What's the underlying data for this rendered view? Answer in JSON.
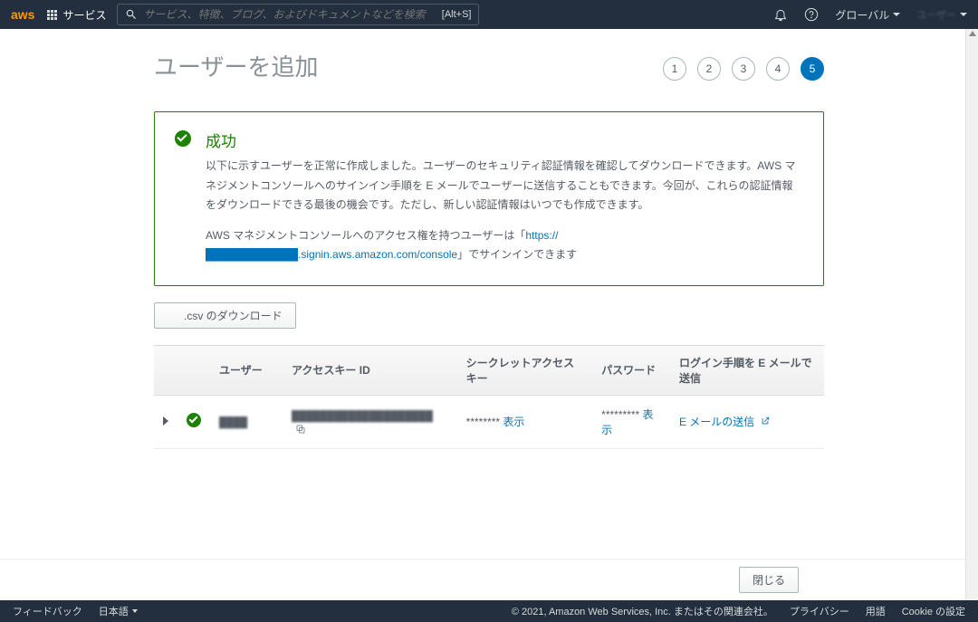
{
  "topnav": {
    "logo": "aws",
    "services": "サービス",
    "search_placeholder": "サービス、特徴、ブログ、およびドキュメントなどを検索",
    "shortcut": "[Alt+S]",
    "region": "グローバル",
    "account": "ユーザー"
  },
  "page": {
    "title": "ユーザーを追加",
    "steps": [
      "1",
      "2",
      "3",
      "4",
      "5"
    ],
    "active_step": 5
  },
  "alert": {
    "title": "成功",
    "body1": "以下に示すユーザーを正常に作成しました。ユーザーのセキュリティ認証情報を確認してダウンロードできます。AWS マネジメントコンソールへのサインイン手順を E メールでユーザーに送信することもできます。今回が、これらの認証情報をダウンロードできる最後の機会です。ただし、新しい認証情報はいつでも作成できます。",
    "body2_pre": "AWS マネジメントコンソールへのアクセス権を持つユーザーは「",
    "body2_link": "https://████████████.signin.aws.amazon.com/console",
    "body2_post": "」でサインインできます"
  },
  "buttons": {
    "download_csv": ".csv のダウンロード",
    "close": "閉じる"
  },
  "table": {
    "headers": {
      "user": "ユーザー",
      "access_key": "アクセスキー ID",
      "secret": "シークレットアクセスキー",
      "password": "パスワード",
      "email": "ログイン手順を E メールで送信"
    },
    "row": {
      "user": "████",
      "access_key": "████████████████████",
      "secret_mask": "********",
      "secret_show": "表示",
      "password_mask": "*********",
      "password_show": "表示",
      "email_link": "E メールの送信"
    }
  },
  "footer": {
    "feedback": "フィードバック",
    "lang": "日本語",
    "copyright": "© 2021, Amazon Web Services, Inc. またはその関連会社。",
    "privacy": "プライバシー",
    "terms": "用語",
    "cookie": "Cookie の設定"
  }
}
